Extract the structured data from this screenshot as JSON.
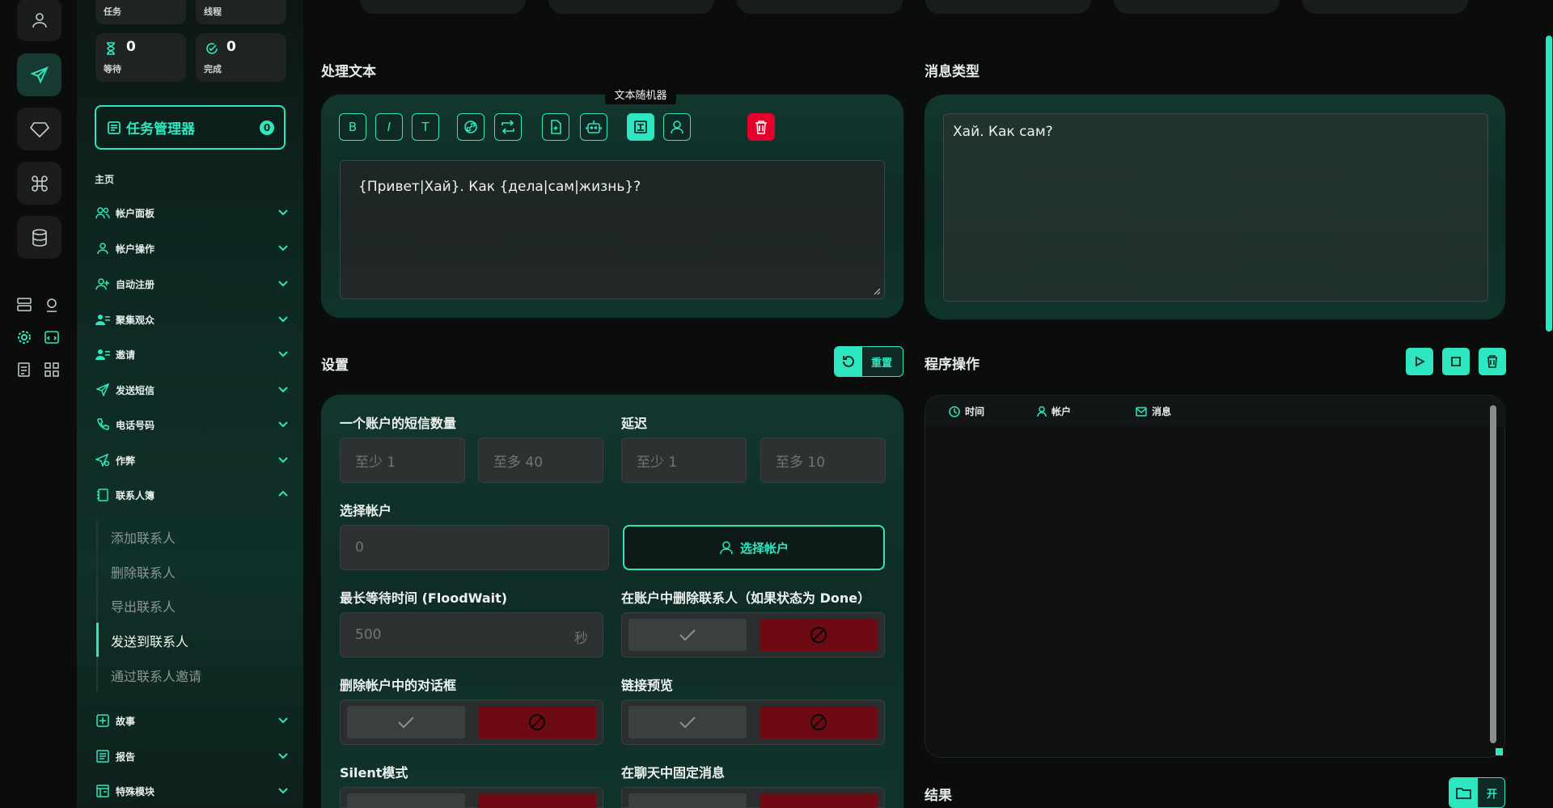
{
  "sidebar": {
    "stats": [
      {
        "label": "任务",
        "value": ""
      },
      {
        "label": "线程",
        "value": ""
      },
      {
        "label": "等待",
        "value": "0",
        "icon": "hourglass-icon"
      },
      {
        "label": "完成",
        "value": "0",
        "icon": "check-circle-icon"
      }
    ],
    "task_manager": {
      "label": "任务管理器",
      "count": "0"
    },
    "section_title": "主页",
    "menu": [
      {
        "label": "帐户面板",
        "icon": "users-icon"
      },
      {
        "label": "帐户操作",
        "icon": "user-icon"
      },
      {
        "label": "自动注册",
        "icon": "user-plus-icon"
      },
      {
        "label": "聚集观众",
        "icon": "user-list-icon"
      },
      {
        "label": "邀请",
        "icon": "user-list-icon"
      },
      {
        "label": "发送短信",
        "icon": "send-icon"
      },
      {
        "label": "电话号码",
        "icon": "phone-icon"
      },
      {
        "label": "作弊",
        "icon": "send-gear-icon"
      },
      {
        "label": "联系人簿",
        "icon": "contact-book-icon",
        "expanded": true
      }
    ],
    "submenu": [
      "添加联系人",
      "删除联系人",
      "导出联系人",
      "发送到联系人",
      "通过联系人邀请"
    ],
    "menu_bottom": [
      {
        "label": "故事",
        "icon": "plus-square-icon"
      },
      {
        "label": "报告",
        "icon": "report-icon"
      },
      {
        "label": "特殊模块",
        "icon": "module-icon"
      }
    ]
  },
  "process_text": {
    "title": "处理文本",
    "tooltip": "文本随机器",
    "toolbar_glyphs": [
      "B",
      "I",
      "T"
    ],
    "text": "{Привет|Хай}. Как {дела|сам|жизнь}?"
  },
  "message_type": {
    "title": "消息类型",
    "text": "Хай. Как сам?"
  },
  "settings": {
    "title": "设置",
    "reset_label": "重置",
    "sms_count_label": "一个账户的短信数量",
    "sms_min_placeholder": "至少 1",
    "sms_max_placeholder": "至多 40",
    "delay_label": "延迟",
    "delay_min_placeholder": "至少 1",
    "delay_max_placeholder": "至多 10",
    "select_account_label": "选择帐户",
    "accounts_value": "0",
    "select_account_button": "选择帐户",
    "floodwait_label": "最长等待时间 (FloodWait)",
    "floodwait_value": "500",
    "floodwait_unit": "秒",
    "delete_contacts_label": "在账户中删除联系人（如果状态为 Done）",
    "delete_dialog_label": "删除帐户中的对话框",
    "link_preview_label": "链接预览",
    "silent_label": "Silent模式",
    "pin_label": "在聊天中固定消息"
  },
  "operations": {
    "title": "程序操作",
    "columns": [
      {
        "label": "时间",
        "icon": "clock-icon"
      },
      {
        "label": "帐户",
        "icon": "user-icon"
      },
      {
        "label": "消息",
        "icon": "mail-icon"
      }
    ]
  },
  "results": {
    "title": "结果",
    "open_label": "开"
  },
  "colors": {
    "accent": "#2ee6c0",
    "danger": "#e5002b",
    "danger_dark": "#6e0a14",
    "background": "#0b0c0c"
  }
}
